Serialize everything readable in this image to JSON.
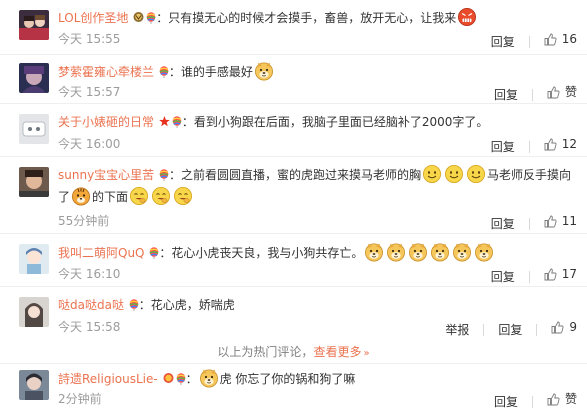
{
  "colors": {
    "username": "#eb7350",
    "link": "#eb7350",
    "meta": "#9c9c9c",
    "text": "#333333"
  },
  "comments": [
    {
      "username": "LOL创作圣地",
      "badges": [
        "vip-medal-icon",
        "rainbow-balloon-icon"
      ],
      "text": "只有摸无心的时候才会摸手，畜兽，放开无心，让我来",
      "emoji_after": [
        "angry-face-emoji"
      ],
      "time": "今天 15:55",
      "reply_label": "回复",
      "likes": "16"
    },
    {
      "username": "梦萦霍雍心牵楼兰",
      "badges": [
        "rainbow-balloon-icon"
      ],
      "text": "谁的手感最好",
      "emoji_after": [
        "doge-emoji"
      ],
      "time": "今天 15:57",
      "reply_label": "回复",
      "likes": "赞"
    },
    {
      "username": "关于小婊砸的日常",
      "badges": [
        "red-star-icon",
        "rainbow-balloon-icon"
      ],
      "text": "看到小狗跟在后面，我脑子里面已经脑补了2000字了。",
      "emoji_after": [],
      "time": "今天 16:00",
      "reply_label": "回复",
      "likes": "12"
    },
    {
      "username": "sunny宝宝心里苦",
      "badges": [
        "rainbow-balloon-icon"
      ],
      "text_part1": "之前看圆圆直播，蜜的虎跑过来摸马老师的胸",
      "text_part2": "马老师反手摸向了",
      "text_part3": "的下面",
      "time": "55分钟前",
      "reply_label": "回复",
      "likes": "11"
    },
    {
      "username": "我叫二萌阿QuQ",
      "badges": [
        "rainbow-balloon-icon"
      ],
      "text": "花心小虎丧天良，我与小狗共存亡。",
      "emoji_after": [
        "doge-emoji",
        "doge-emoji",
        "doge-emoji",
        "doge-emoji",
        "doge-emoji",
        "doge-emoji"
      ],
      "time": "今天 16:10",
      "reply_label": "回复",
      "likes": "17"
    },
    {
      "username": "哒da哒da哒",
      "badges": [
        "rainbow-balloon-icon"
      ],
      "text": "花心虎，娇喘虎",
      "emoji_after": [],
      "time": "今天 15:58",
      "report_label": "举报",
      "reply_label": "回复",
      "likes": "9"
    },
    {
      "username": "詩遗ReligiousLie-",
      "badges": [
        "vip-medal-icon",
        "rainbow-balloon-icon"
      ],
      "text": "虎 你忘了你的锅和狗了嘛",
      "emoji_before": [
        "doge-emoji"
      ],
      "time": "2分钟前",
      "reply_label": "回复",
      "likes": "赞"
    }
  ],
  "hot_comments": {
    "prefix": "以上为热门评论，",
    "more_label": "查看更多",
    "arrow": "»"
  },
  "separator": "："
}
